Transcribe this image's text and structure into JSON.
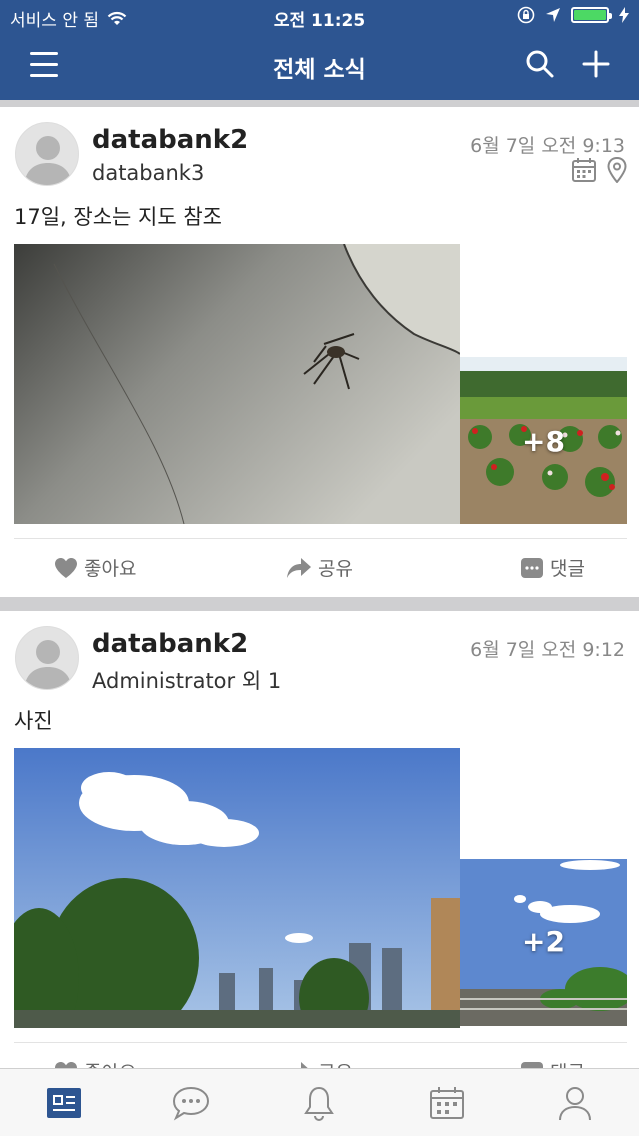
{
  "status_bar": {
    "carrier": "서비스 안 됨",
    "time": "오전 11:25"
  },
  "header": {
    "title": "전체 소식"
  },
  "posts": [
    {
      "author": "databank2",
      "recipient": "databank3",
      "date": "6월 7일 오전 9:13",
      "text": "17일, 장소는 지도 참조",
      "more_photos": "+8"
    },
    {
      "author": "databank2",
      "recipient": "Administrator 외 1",
      "date": "6월 7일 오전 9:12",
      "text": "사진",
      "more_photos": "+2"
    }
  ],
  "actions": {
    "like": "좋아요",
    "share": "공유",
    "comment": "댓글"
  },
  "colors": {
    "header": "#2d5591",
    "tab_active": "#2d5591",
    "battery": "#4cd964"
  },
  "tabbar": {
    "items": [
      "news-feed-icon",
      "chat-icon",
      "bell-icon",
      "calendar-icon",
      "person-icon"
    ],
    "active": "news-feed-icon"
  }
}
